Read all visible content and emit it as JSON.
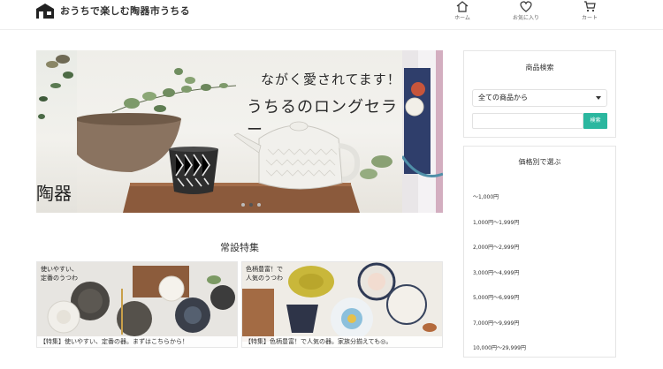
{
  "header": {
    "site_title": "おうちで楽しむ陶器市うちる",
    "nav": [
      {
        "label": "ホーム",
        "icon": "home-icon"
      },
      {
        "label": "お気に入り",
        "icon": "heart-icon"
      },
      {
        "label": "カート",
        "icon": "cart-icon"
      }
    ]
  },
  "hero": {
    "copy_line1": "ながく愛されてます！",
    "copy_line2": "うちるのロングセラー",
    "left_slide_text": "陶器",
    "slide_count": 3,
    "active_slide": 1
  },
  "features": {
    "title": "常設特集",
    "cards": [
      {
        "tag_line1": "使いやすい、",
        "tag_line2": "定番のうつわ",
        "caption": "【特集】使いやすい、定番の器。まずはこちらから！"
      },
      {
        "tag_line1": "色柄豊富！で",
        "tag_line2": "人気のうつわ",
        "caption": "【特集】色柄豊富！で人気の器。家族分揃えても◎。"
      }
    ]
  },
  "sidebar": {
    "search": {
      "title": "商品検索",
      "category_selected": "全ての商品から",
      "keyword_value": "",
      "button_label": "検索"
    },
    "price": {
      "title": "価格別で選ぶ",
      "ranges": [
        "～1,000円",
        "1,000円～1,999円",
        "2,000円～2,999円",
        "3,000円～4,999円",
        "5,000円～6,999円",
        "7,000円～9,999円",
        "10,000円～29,999円"
      ]
    }
  },
  "colors": {
    "accent": "#2bb79f",
    "text": "#333333"
  }
}
